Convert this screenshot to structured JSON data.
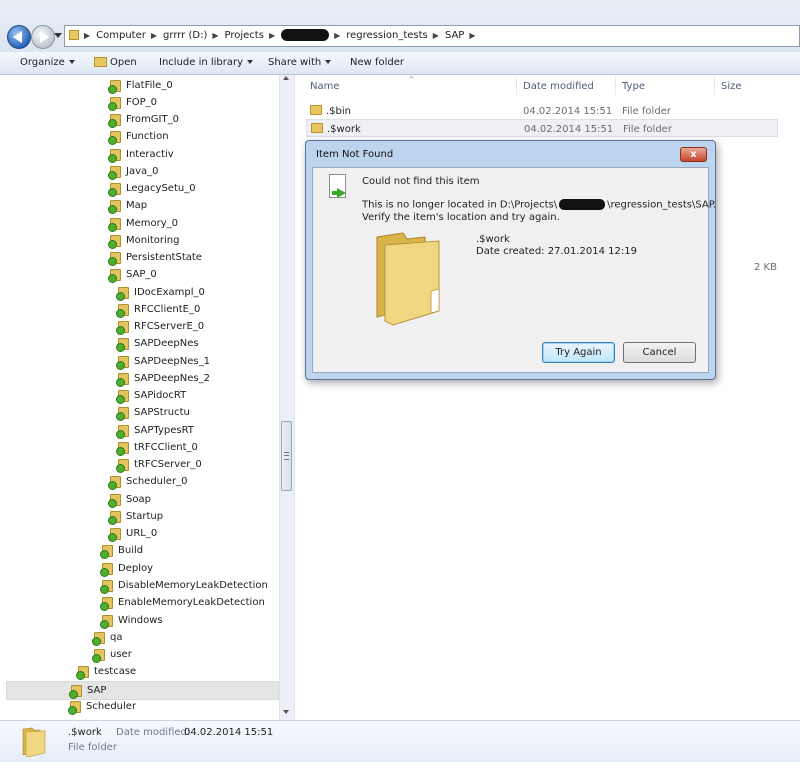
{
  "address_bar": {
    "crumbs": [
      "Computer",
      "grrrr (D:)",
      "Projects",
      "regression_tests",
      "SAP"
    ]
  },
  "toolbar": {
    "organize": "Organize",
    "open": "Open",
    "include": "Include in library",
    "share": "Share with",
    "new_folder": "New folder"
  },
  "tree": {
    "items": [
      "FlatFile_0",
      "FOP_0",
      "FromGIT_0",
      "Function",
      "Interactiv",
      "Java_0",
      "LegacySetu_0",
      "Map",
      "Memory_0",
      "Monitoring",
      "PersistentState",
      "SAP_0",
      "IDocExampl_0",
      "RFCClientE_0",
      "RFCServerE_0",
      "SAPDeepNes",
      "SAPDeepNes_1",
      "SAPDeepNes_2",
      "SAPidocRT",
      "SAPStructu",
      "SAPTypesRT",
      "tRFCClient_0",
      "tRFCServer_0",
      "Scheduler_0",
      "Soap",
      "Startup",
      "URL_0",
      "Build",
      "Deploy",
      "DisableMemoryLeakDetection",
      "EnableMemoryLeakDetection",
      "Windows",
      "qa",
      "user",
      "testcase",
      "SAP",
      "Scheduler"
    ]
  },
  "filelist": {
    "columns": {
      "name": "Name",
      "date": "Date modified",
      "type": "Type",
      "size": "Size"
    },
    "rows": [
      {
        "name": ".$bin",
        "date": "04.02.2014 15:51",
        "type": "File folder"
      },
      {
        "name": ".$work",
        "date": "04.02.2014 15:51",
        "type": "File folder"
      }
    ],
    "size_value": "2 KB"
  },
  "dialog": {
    "title": "Item Not Found",
    "close": "x",
    "heading": "Could not find this item",
    "line1_a": "This is no longer located in D:\\Projects\\",
    "line1_b": "\\regression_tests\\SAP.",
    "line2": "Verify the item's location and try again.",
    "item_name": ".$work",
    "item_created": "Date created: 27.01.2014 12:19",
    "try_again": "Try Again",
    "cancel": "Cancel"
  },
  "details": {
    "name": ".$work",
    "date_label": "Date modified:",
    "date_value": "04.02.2014 15:51",
    "type": "File folder"
  }
}
